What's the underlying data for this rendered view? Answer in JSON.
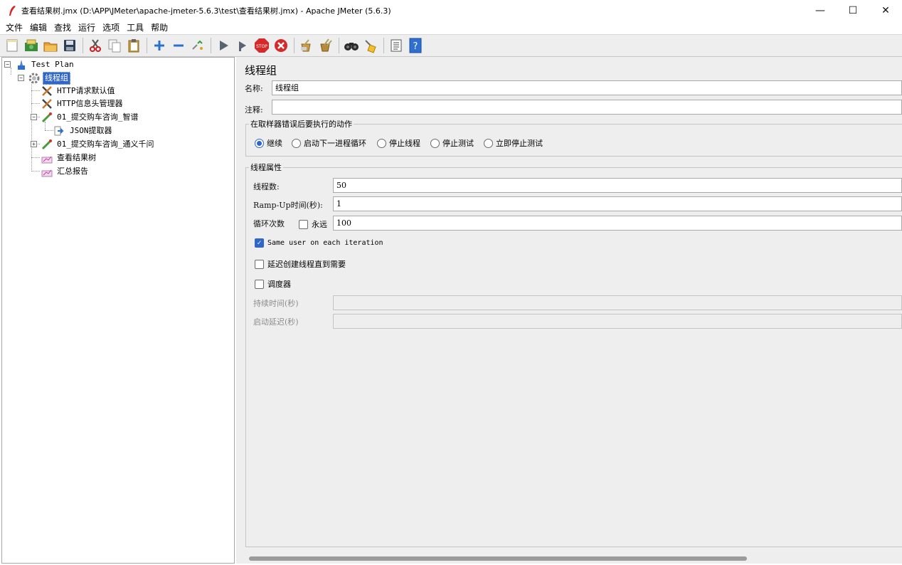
{
  "window": {
    "title": "查看结果树.jmx (D:\\APP\\JMeter\\apache-jmeter-5.6.3\\test\\查看结果树.jmx) - Apache JMeter (5.6.3)",
    "minimize": "—",
    "maximize": "☐",
    "close": "✕"
  },
  "menu": [
    "文件",
    "编辑",
    "查找",
    "运行",
    "选项",
    "工具",
    "帮助"
  ],
  "toolbar": [
    "new-icon",
    "templates-icon",
    "open-icon",
    "save-icon",
    "cut-icon",
    "copy-icon",
    "paste-icon",
    "expand-icon",
    "collapse-icon",
    "toggle-icon",
    "start-icon",
    "start-no-pause-icon",
    "stop-icon",
    "shutdown-icon",
    "clear-icon",
    "clear-all-icon",
    "search-icon",
    "reset-search-icon",
    "function-helper-icon",
    "help-icon"
  ],
  "tree": {
    "test_plan": "Test Plan",
    "thread_group": "线程组",
    "http_defaults": "HTTP请求默认值",
    "http_headers": "HTTP信息头管理器",
    "sampler1": "01_提交购车咨询_智谱",
    "json_extractor": "JSON提取器",
    "sampler2": "01_提交购车咨询_通义千问",
    "view_results_tree": "查看结果树",
    "summary_report": "汇总报告"
  },
  "panel": {
    "title": "线程组",
    "name_label": "名称:",
    "name_value": "线程组",
    "comment_label": "注释:",
    "comment_value": "",
    "error_action_title": "在取样器错误后要执行的动作",
    "error_actions": [
      {
        "label": "继续",
        "selected": true
      },
      {
        "label": "启动下一进程循环",
        "selected": false
      },
      {
        "label": "停止线程",
        "selected": false
      },
      {
        "label": "停止测试",
        "selected": false
      },
      {
        "label": "立即停止测试",
        "selected": false
      }
    ],
    "thread_props_title": "线程属性",
    "threads_label": "线程数:",
    "threads_value": "50",
    "rampup_label": "Ramp-Up时间(秒):",
    "rampup_value": "1",
    "loop_label": "循环次数",
    "forever_label": "永远",
    "forever_checked": false,
    "loop_value": "100",
    "same_user_label": "Same user on each iteration",
    "same_user_checked": true,
    "delay_label": "延迟创建线程直到需要",
    "delay_checked": false,
    "scheduler_label": "调度器",
    "scheduler_checked": false,
    "duration_label": "持续时间(秒)",
    "duration_value": "",
    "startup_delay_label": "启动延迟(秒)",
    "startup_delay_value": ""
  }
}
